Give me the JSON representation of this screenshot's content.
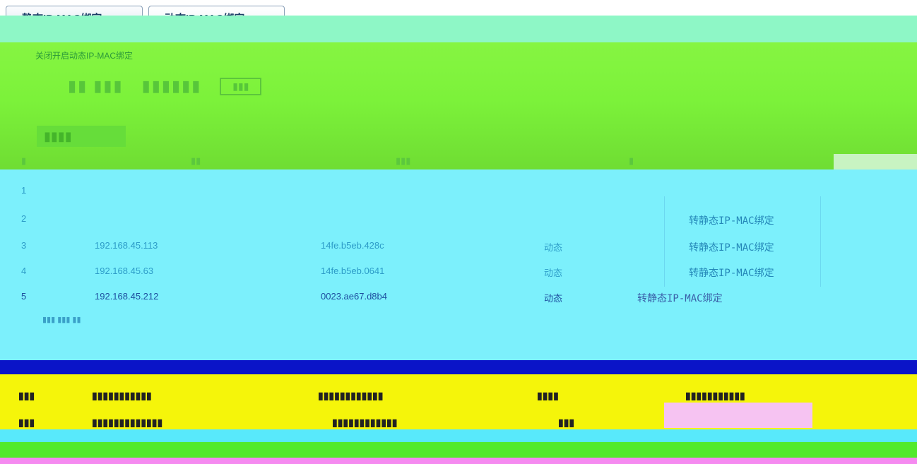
{
  "tabs": [
    {
      "label": "静态IP-MAC绑定"
    },
    {
      "label": "动态IP-MAC绑定"
    }
  ],
  "notice": "关闭开启动态IP-MAC绑定",
  "colors": {
    "tab_text": "#1c3d67",
    "band_mint": "#8ef7c6",
    "band_green": "#7cf23a",
    "table_bg": "#7cf0fc",
    "band_blue": "#0a14c8",
    "band_yellow": "#f5f50a",
    "band_pink": "#f58af0"
  },
  "table": {
    "rows": [
      {
        "no": "1",
        "ip": "",
        "mac": "",
        "status": "",
        "action": ""
      },
      {
        "no": "2",
        "ip": "",
        "mac": "",
        "status": "",
        "action": "转静态IP-MAC绑定"
      },
      {
        "no": "3",
        "ip": "192.168.45.113",
        "mac": "14fe.b5eb.428c",
        "status": "动态",
        "action": "转静态IP-MAC绑定"
      },
      {
        "no": "4",
        "ip": "192.168.45.63",
        "mac": "14fe.b5eb.0641",
        "status": "动态",
        "action": "转静态IP-MAC绑定"
      },
      {
        "no": "5",
        "ip": "192.168.45.212",
        "mac": "0023.ae67.d8b4",
        "status": "动态",
        "action": "转静态IP-MAC绑定"
      }
    ]
  }
}
